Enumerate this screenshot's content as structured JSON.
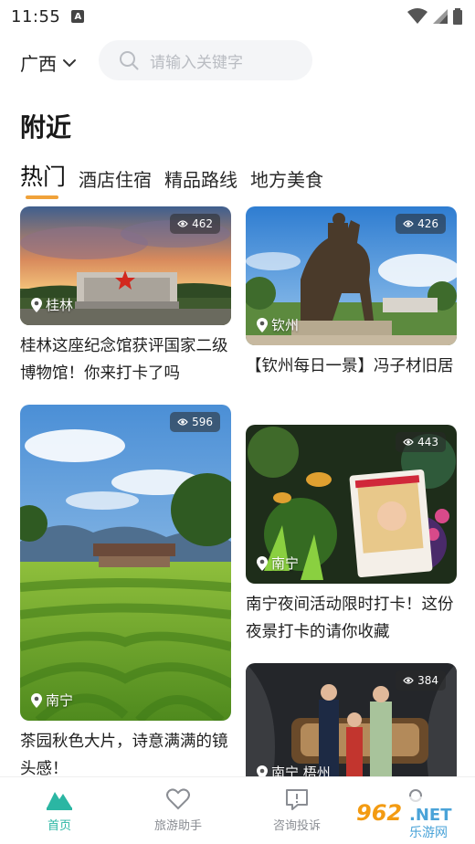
{
  "status": {
    "time": "11:55",
    "a_badge": "A"
  },
  "header": {
    "city": "广西",
    "search_placeholder": "请输入关键字"
  },
  "section": {
    "title": "附近"
  },
  "tabs": [
    {
      "label": "热门",
      "active": true
    },
    {
      "label": "酒店住宿"
    },
    {
      "label": "精品路线"
    },
    {
      "label": "地方美食"
    }
  ],
  "cards": [
    {
      "views": "462",
      "location": "桂林",
      "title": "桂林这座纪念馆获评国家二级博物馆！你来打卡了吗"
    },
    {
      "views": "426",
      "location": "钦州",
      "title": "【钦州每日一景】冯子材旧居"
    },
    {
      "views": "596",
      "location": "南宁",
      "title": "茶园秋色大片，诗意满满的镜头感！"
    },
    {
      "views": "443",
      "location": "南宁",
      "title": "南宁夜间活动限时打卡！这份夜景打卡的请你收藏"
    },
    {
      "views": "384",
      "location": "南宁 梧州",
      "title": ""
    }
  ],
  "nav": [
    {
      "label": "首页",
      "active": true
    },
    {
      "label": "旅游助手"
    },
    {
      "label": "咨询投诉"
    }
  ],
  "watermark": {
    "number": "962",
    "suffix": ".NET",
    "site": "乐游网"
  },
  "colors": {
    "accent": "#2bb6a3",
    "tab_underline": "#f0a23a",
    "muted": "#8a8d93"
  }
}
